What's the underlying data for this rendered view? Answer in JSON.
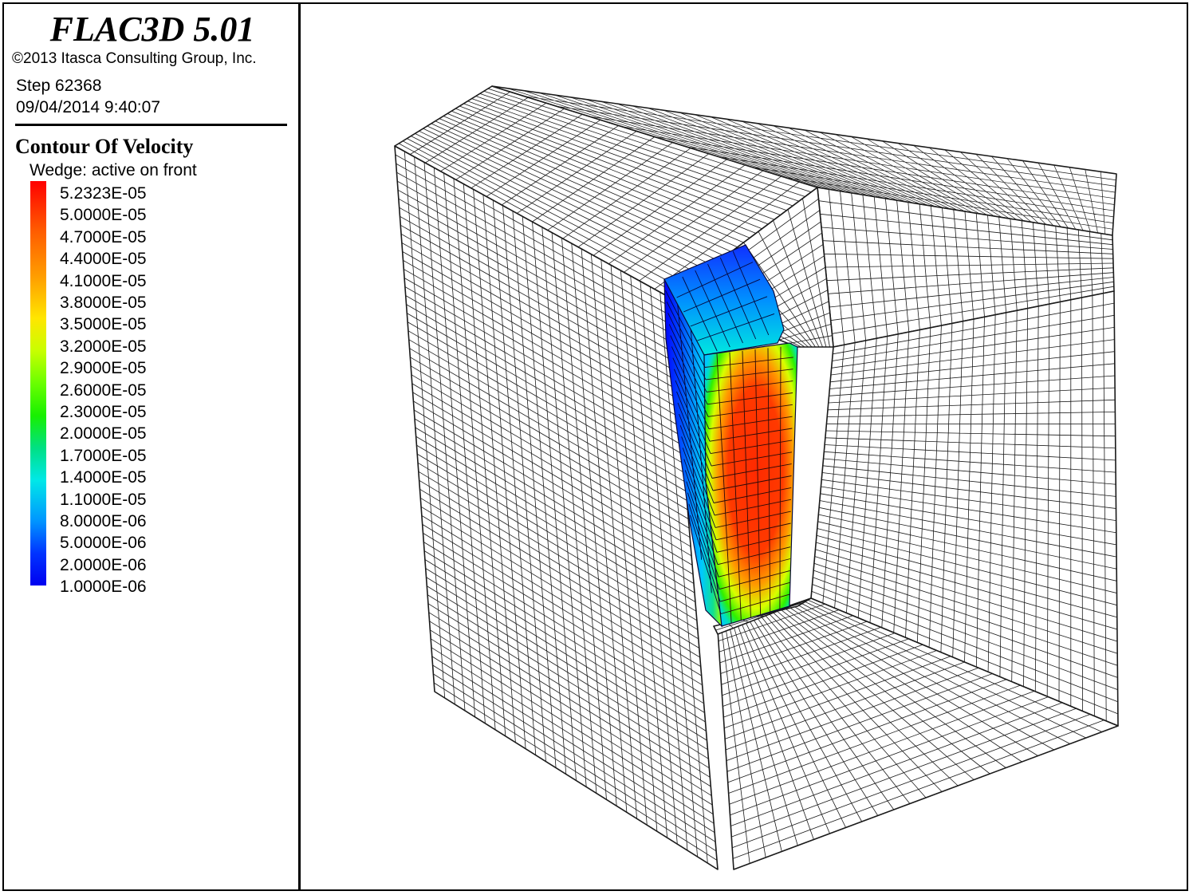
{
  "app": {
    "title": "FLAC3D 5.01",
    "copyright": "©2013 Itasca Consulting Group, Inc."
  },
  "run": {
    "step": "Step 62368",
    "timestamp": "09/04/2014 9:40:07"
  },
  "legend": {
    "title": "Contour Of Velocity",
    "subtitle": "Wedge: active on front",
    "levels": [
      "5.2323E-05",
      "5.0000E-05",
      "4.7000E-05",
      "4.4000E-05",
      "4.1000E-05",
      "3.8000E-05",
      "3.5000E-05",
      "3.2000E-05",
      "2.9000E-05",
      "2.6000E-05",
      "2.3000E-05",
      "2.0000E-05",
      "1.7000E-05",
      "1.4000E-05",
      "1.1000E-05",
      "8.0000E-06",
      "5.0000E-06",
      "2.0000E-06",
      "1.0000E-06"
    ],
    "colormap": [
      "#ff0000",
      "#ff5a00",
      "#ffa000",
      "#ffe600",
      "#c8ff00",
      "#6aff00",
      "#18f000",
      "#00e084",
      "#00e8e8",
      "#0096ff",
      "#0034ff",
      "#0000f0"
    ]
  },
  "colors": {
    "mesh": "#1a1a1a",
    "background": "#ffffff"
  }
}
